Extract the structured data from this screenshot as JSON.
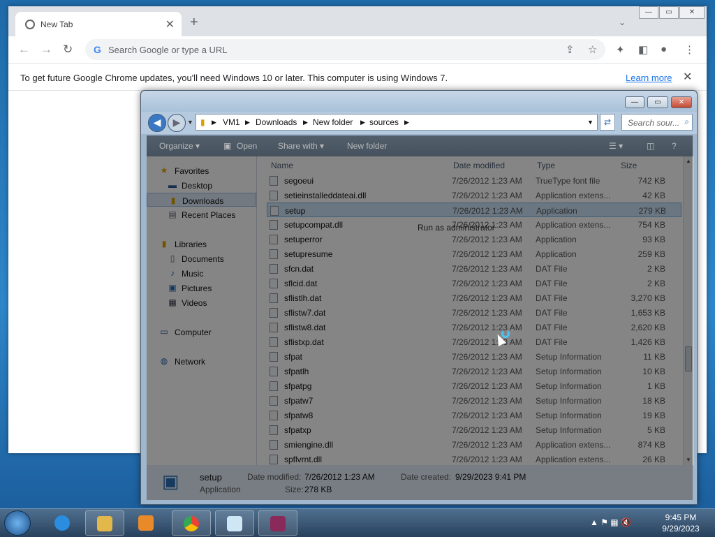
{
  "chrome": {
    "tab_title": "New Tab",
    "tab_close": "✕",
    "new_tab": "+",
    "tab_search": "⌄",
    "omnibox_placeholder": "Search Google or type a URL",
    "omnibox_g": "G",
    "infobar_message": "To get future Google Chrome updates, you'll need Windows 10 or later. This computer is using Windows 7.",
    "infobar_link": "Learn more",
    "infobar_close": "✕",
    "win_min": "—",
    "win_max": "▭",
    "win_close": "✕"
  },
  "explorer": {
    "breadcrumbs": [
      "VM1",
      "Downloads",
      "New folder",
      "sources"
    ],
    "search_placeholder": "Search sour...",
    "toolbar": {
      "organize": "Organize ▾",
      "open": "Open",
      "share_with": "Share with ▾",
      "new_folder": "New folder"
    },
    "nav": {
      "favorites": "Favorites",
      "desktop": "Desktop",
      "downloads": "Downloads",
      "recent": "Recent Places",
      "libraries": "Libraries",
      "documents": "Documents",
      "music": "Music",
      "pictures": "Pictures",
      "videos": "Videos",
      "computer": "Computer",
      "network": "Network"
    },
    "columns": {
      "name": "Name",
      "date": "Date modified",
      "type": "Type",
      "size": "Size"
    },
    "files": [
      {
        "name": "segoeui",
        "date": "7/26/2012 1:23 AM",
        "type": "TrueType font file",
        "size": "742 KB"
      },
      {
        "name": "setieinstalleddateai.dll",
        "date": "7/26/2012 1:23 AM",
        "type": "Application extens...",
        "size": "42 KB"
      },
      {
        "name": "setup",
        "date": "7/26/2012 1:23 AM",
        "type": "Application",
        "size": "279 KB"
      },
      {
        "name": "setupcompat.dll",
        "date": "7/26/2012 1:23 AM",
        "type": "Application extens...",
        "size": "754 KB"
      },
      {
        "name": "setuperror",
        "date": "7/26/2012 1:23 AM",
        "type": "Application",
        "size": "93 KB"
      },
      {
        "name": "setupresume",
        "date": "7/26/2012 1:23 AM",
        "type": "Application",
        "size": "259 KB"
      },
      {
        "name": "sfcn.dat",
        "date": "7/26/2012 1:23 AM",
        "type": "DAT File",
        "size": "2 KB"
      },
      {
        "name": "sflcid.dat",
        "date": "7/26/2012 1:23 AM",
        "type": "DAT File",
        "size": "2 KB"
      },
      {
        "name": "sflistlh.dat",
        "date": "7/26/2012 1:23 AM",
        "type": "DAT File",
        "size": "3,270 KB"
      },
      {
        "name": "sflistw7.dat",
        "date": "7/26/2012 1:23 AM",
        "type": "DAT File",
        "size": "1,653 KB"
      },
      {
        "name": "sflistw8.dat",
        "date": "7/26/2012 1:23 AM",
        "type": "DAT File",
        "size": "2,620 KB"
      },
      {
        "name": "sflistxp.dat",
        "date": "7/26/2012 1:23 AM",
        "type": "DAT File",
        "size": "1,426 KB"
      },
      {
        "name": "sfpat",
        "date": "7/26/2012 1:23 AM",
        "type": "Setup Information",
        "size": "11 KB"
      },
      {
        "name": "sfpatlh",
        "date": "7/26/2012 1:23 AM",
        "type": "Setup Information",
        "size": "10 KB"
      },
      {
        "name": "sfpatpg",
        "date": "7/26/2012 1:23 AM",
        "type": "Setup Information",
        "size": "1 KB"
      },
      {
        "name": "sfpatw7",
        "date": "7/26/2012 1:23 AM",
        "type": "Setup Information",
        "size": "18 KB"
      },
      {
        "name": "sfpatw8",
        "date": "7/26/2012 1:23 AM",
        "type": "Setup Information",
        "size": "19 KB"
      },
      {
        "name": "sfpatxp",
        "date": "7/26/2012 1:23 AM",
        "type": "Setup Information",
        "size": "5 KB"
      },
      {
        "name": "smiengine.dll",
        "date": "7/26/2012 1:23 AM",
        "type": "Application extens...",
        "size": "874 KB"
      },
      {
        "name": "spflvrnt.dll",
        "date": "7/26/2012 1:23 AM",
        "type": "Application extens...",
        "size": "26 KB"
      }
    ],
    "context_menu_item": "Run as administrator",
    "details": {
      "name": "setup",
      "type": "Application",
      "modified_label": "Date modified:",
      "modified_value": "7/26/2012 1:23 AM",
      "created_label": "Date created:",
      "created_value": "9/29/2023 9:41 PM",
      "size_label": "Size:",
      "size_value": "278 KB"
    }
  },
  "taskbar": {
    "time": "9:45 PM",
    "date": "9/29/2023"
  }
}
